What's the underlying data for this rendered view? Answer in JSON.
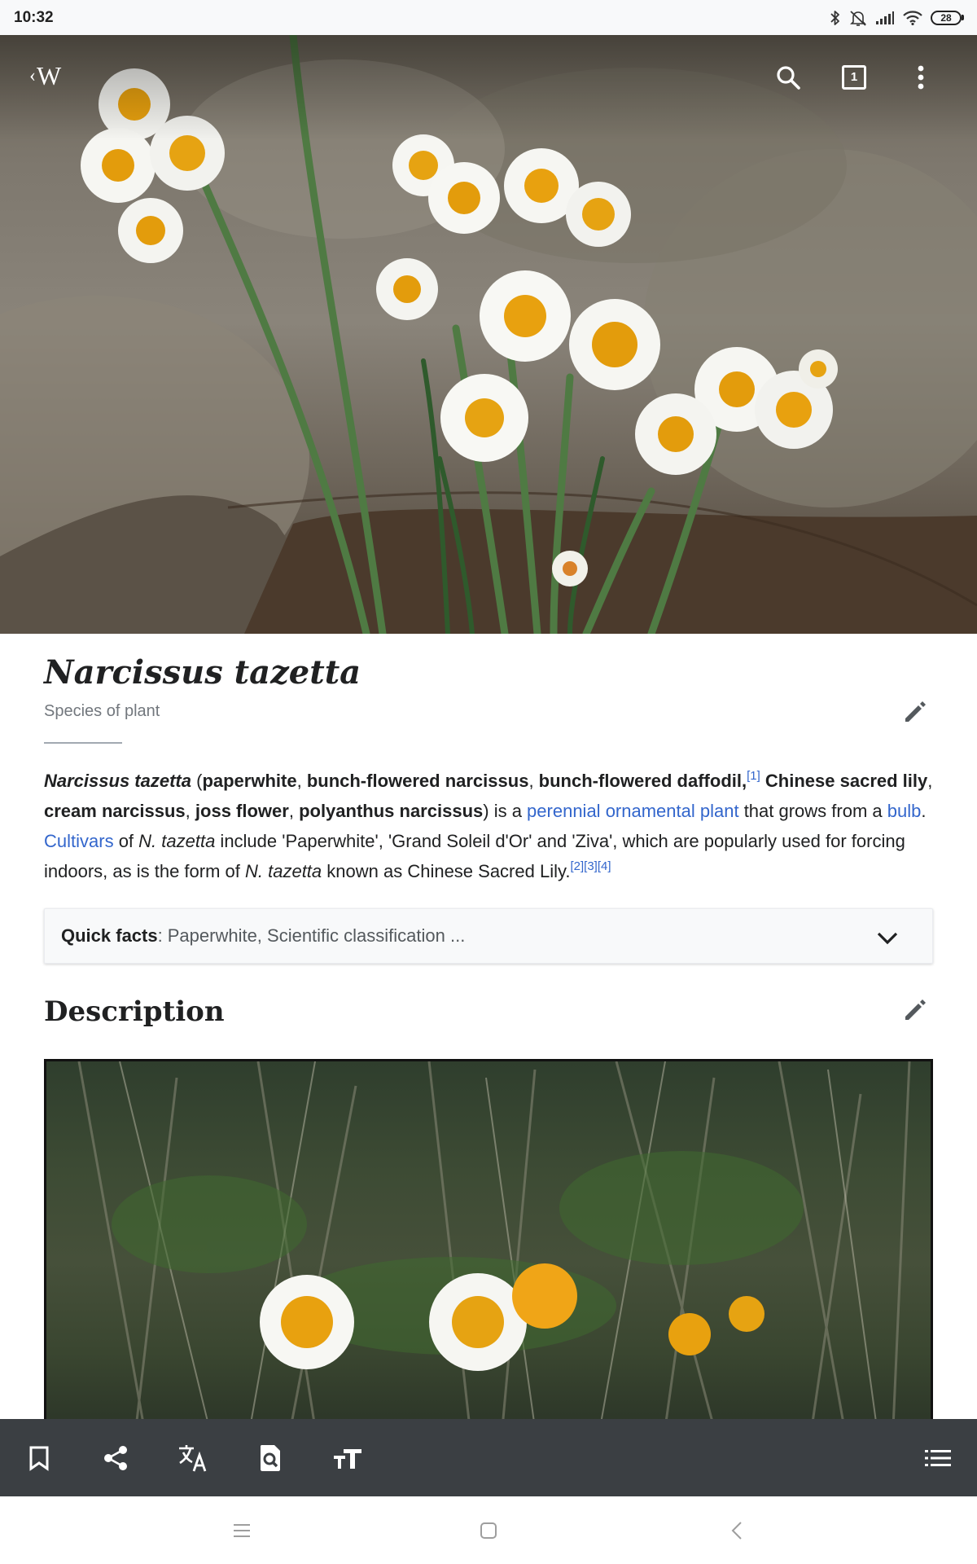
{
  "status_bar": {
    "time": "10:32",
    "battery": "28",
    "icons": [
      "bluetooth-icon",
      "mute-icon",
      "signal-icon",
      "wifi-icon",
      "battery-icon"
    ]
  },
  "top_bar": {
    "logo_text": "W",
    "tabs_count": "1",
    "icons": [
      "back-chevron-icon",
      "search-icon",
      "tabs-icon",
      "more-vert-icon"
    ]
  },
  "article": {
    "title": "Narcissus tazetta",
    "subtitle": "Species of plant",
    "lead": {
      "name": "Narcissus tazetta",
      "open_paren": " (",
      "alt1": "paperwhite",
      "c1": ", ",
      "alt2": "bunch-flowered narcissus",
      "c2": ", ",
      "alt3": "bunch-flowered daffodil,",
      "ref1": "[1]",
      "space": " ",
      "alt4": "Chinese sacred lily",
      "c3": ", ",
      "alt5": "cream narcissus",
      "c4": ", ",
      "alt6": "joss flower",
      "c5": ", ",
      "alt7": "polyanthus narcissus",
      "t1": ") is a ",
      "link_perennial": "perennial",
      "t2": " ",
      "link_ornamental": "ornamental plant",
      "t3": " that grows from a ",
      "link_bulb": "bulb",
      "t4": ". ",
      "link_cultivars": "Cultivars",
      "t5": " of ",
      "abbr1": "N. tazetta",
      "t6": " include 'Paperwhite', 'Grand Soleil d'Or' and 'Ziva', which are popularly used for forcing indoors, as is the form of ",
      "abbr2": "N. tazetta",
      "t7": " known as Chinese Sacred Lily.",
      "ref2": "[2]",
      "ref3": "[3]",
      "ref4": "[4]"
    },
    "quick_facts": {
      "label": "Quick facts",
      "separator": ":",
      "value": "Paperwhite, Scientific classification ..."
    },
    "section_title": "Description"
  },
  "toolbar": {
    "icons": [
      "bookmark-icon",
      "share-icon",
      "translate-icon",
      "find-in-page-icon",
      "text-size-icon",
      "table-of-contents-icon"
    ]
  },
  "nav_bar": {
    "icons": [
      "recent-apps-icon",
      "home-icon",
      "back-icon"
    ]
  },
  "colors": {
    "link": "#3366cc",
    "toolbar_bg": "#3b3f43",
    "status_bg": "#f8f9fa",
    "secondary_text": "#72777d"
  }
}
